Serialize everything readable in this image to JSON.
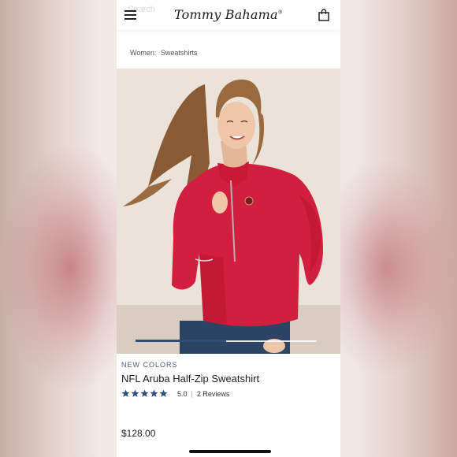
{
  "header": {
    "search_placeholder": "Search",
    "logo": "Tommy Bahama",
    "logo_mark": "®",
    "menu_icon": "hamburger-menu-icon",
    "bag_icon": "shopping-bag-icon"
  },
  "breadcrumb": {
    "items": [
      "Women:",
      "Sweatshirts"
    ]
  },
  "gallery": {
    "image_alt": "Model wearing red NFL Aruba Half-Zip Sweatshirt",
    "slides_total": 2,
    "active_slide": 1
  },
  "product": {
    "badge": "NEW COLORS",
    "title": "NFL Aruba Half-Zip Sweatshirt",
    "rating": "5.0",
    "stars": 5,
    "reviews": "2 Reviews",
    "price": "$128.00"
  },
  "colors": {
    "accent": "#2f4f7a",
    "sweater_red": "#d21f3f",
    "star_blue": "#2f4f7a"
  }
}
